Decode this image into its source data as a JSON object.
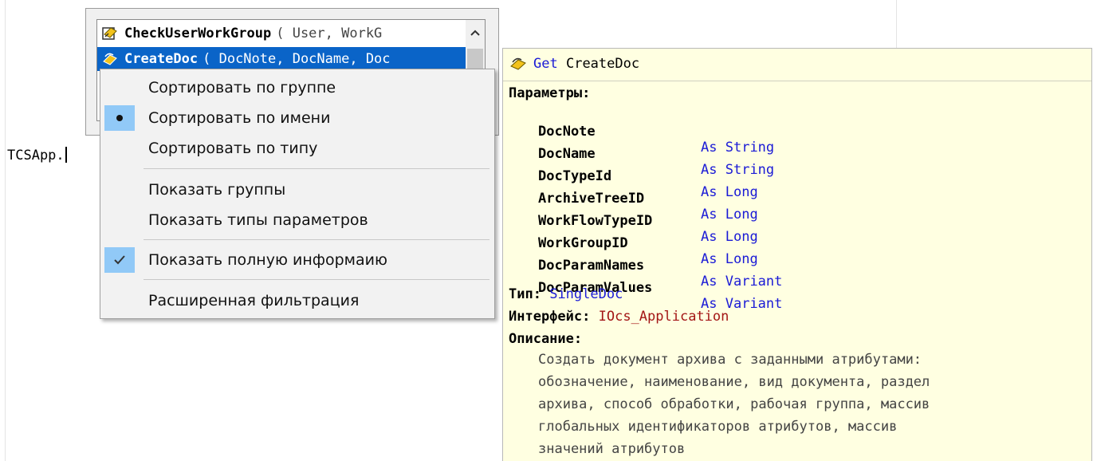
{
  "editor": {
    "text": "TCSApp."
  },
  "completion_list": {
    "items": [
      {
        "name": "CheckUserWorkGroup",
        "params": "( User, WorkG",
        "icon": "method-icon",
        "selected": false
      },
      {
        "name": "CreateDoc",
        "params": "( DocNote, DocName, Doc",
        "icon": "property-get-icon",
        "selected": true
      }
    ]
  },
  "context_menu": {
    "items": [
      {
        "label": "Сортировать по группе",
        "mark": ""
      },
      {
        "label": "Сортировать по имени",
        "mark": "bullet"
      },
      {
        "label": "Сортировать по типу",
        "mark": ""
      },
      {
        "label": "Показать группы",
        "mark": ""
      },
      {
        "label": "Показать типы параметров",
        "mark": ""
      },
      {
        "label": "Показать полную информаию",
        "mark": "check"
      },
      {
        "label": "Расширенная фильтрация",
        "mark": ""
      }
    ]
  },
  "tooltip": {
    "accessor": "Get",
    "name": "CreateDoc",
    "params_label": "Параметры:",
    "as_keyword": "As",
    "params": [
      {
        "name": "DocNote",
        "type": "String"
      },
      {
        "name": "DocName",
        "type": "String"
      },
      {
        "name": "DocTypeId",
        "type": "Long"
      },
      {
        "name": "ArchiveTreeID",
        "type": "Long"
      },
      {
        "name": "WorkFlowTypeID",
        "type": "Long"
      },
      {
        "name": "WorkGroupID",
        "type": "Long"
      },
      {
        "name": "DocParamNames",
        "type": "Variant"
      },
      {
        "name": "DocParamValues",
        "type": "Variant"
      }
    ],
    "type_label": "Тип:",
    "type_value": "SingleDoc",
    "interface_label": "Интерфейс:",
    "interface_value": "IOcs_Application",
    "description_label": "Описание:",
    "description_lines": [
      "Создать документ архива с заданными атрибутами:",
      "обозначение, наименование, вид документа, раздел",
      "архива, способ обработки, рабочая группа, массив",
      "глобальных идентификаторов атрибутов, массив",
      "значений атрибутов"
    ]
  },
  "colors": {
    "selection": "#0a64c8",
    "menu_mark": "#91c9f7",
    "tooltip_bg": "#ffffe1",
    "keyword": "#1a1ad6",
    "interface": "#a31515"
  }
}
